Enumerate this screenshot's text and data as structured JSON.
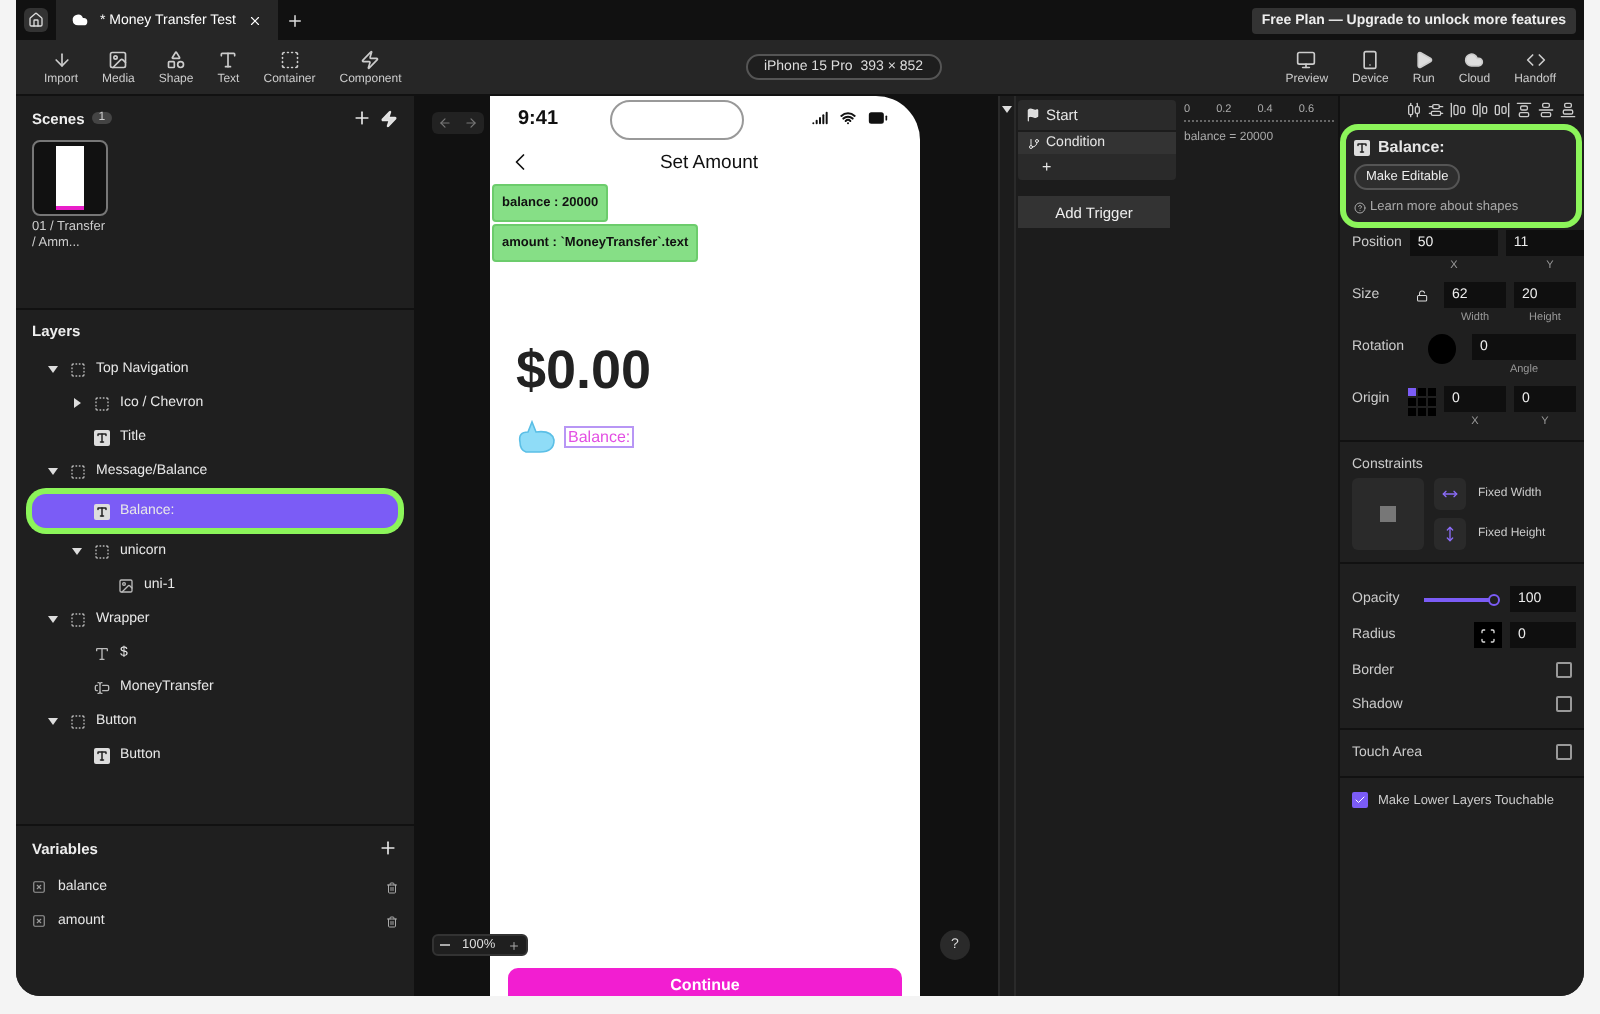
{
  "tabs": [
    {
      "label": "* Money Transfer Test",
      "selected": true
    }
  ],
  "plan_banner": "Free Plan — Upgrade to unlock more features",
  "toolbar": {
    "left": [
      {
        "label": "Import",
        "kind": "import"
      },
      {
        "label": "Media",
        "kind": "media"
      },
      {
        "label": "Shape",
        "kind": "shape"
      },
      {
        "label": "Text",
        "kind": "text"
      },
      {
        "label": "Container",
        "kind": "container"
      },
      {
        "label": "Component",
        "kind": "component"
      }
    ],
    "device": "iPhone 15 Pro  393 × 852",
    "right": [
      {
        "label": "Preview",
        "kind": "preview"
      },
      {
        "label": "Device",
        "kind": "device"
      },
      {
        "label": "Run",
        "kind": "run"
      },
      {
        "label": "Cloud",
        "kind": "cloud"
      },
      {
        "label": "Handoff",
        "kind": "handoff"
      }
    ]
  },
  "scenes": {
    "title": "Scenes",
    "count": "1",
    "items": [
      {
        "caption": "01 / Transfer / Amm...",
        "selected": true
      }
    ]
  },
  "layers": {
    "title": "Layers",
    "items": [
      {
        "name": "Top Navigation",
        "kind": "container",
        "expanded": true,
        "selected": false,
        "children": [
          {
            "name": "Ico / Chevron",
            "kind": "container",
            "expanded": false,
            "selected": false
          },
          {
            "name": "Title",
            "kind": "textbox",
            "selected": false
          }
        ]
      },
      {
        "name": "Message/Balance",
        "kind": "container",
        "expanded": true,
        "selected": false,
        "children": [
          {
            "name": "Balance:",
            "kind": "textbox",
            "selected": true
          },
          {
            "name": "unicorn",
            "kind": "container",
            "expanded": true,
            "selected": false,
            "children": [
              {
                "name": "uni-1",
                "kind": "image",
                "selected": false
              }
            ]
          }
        ]
      },
      {
        "name": "Wrapper",
        "kind": "container",
        "expanded": true,
        "selected": false,
        "children": [
          {
            "name": "$",
            "kind": "text",
            "selected": false
          },
          {
            "name": "MoneyTransfer",
            "kind": "input",
            "selected": false
          }
        ]
      },
      {
        "name": "Button",
        "kind": "container",
        "expanded": true,
        "selected": false,
        "children": [
          {
            "name": "Button",
            "kind": "textbox",
            "selected": false
          }
        ]
      }
    ]
  },
  "variables": {
    "title": "Variables",
    "items": [
      {
        "name": "balance"
      },
      {
        "name": "amount"
      }
    ]
  },
  "canvas": {
    "zoom": "100%",
    "help": "?",
    "phone": {
      "time": "9:41",
      "title": "Set Amount",
      "tags": [
        "balance : 20000",
        "amount : `MoneyTransfer`.text"
      ],
      "amount": "$0.00",
      "balance_label": "Balance:",
      "button": "Continue"
    }
  },
  "logic": {
    "start": "Start",
    "condition": "Condition",
    "add": "+",
    "add_trigger": "Add Trigger",
    "ticks": [
      "0",
      "0.2",
      "0.4",
      "0.6"
    ],
    "expression": "balance = 20000"
  },
  "inspector": {
    "name": "Balance:",
    "highlighted": true,
    "make_editable": "Make Editable",
    "learn_more": "Learn more about shapes",
    "rows": [
      {
        "label": "Position",
        "kind": "position",
        "inputs": [
          {
            "value": "50",
            "caption": "X"
          },
          {
            "value": "11",
            "caption": "Y"
          }
        ]
      },
      {
        "label": "Size",
        "kind": "size",
        "inputs": [
          {
            "value": "62",
            "caption": "Width"
          },
          {
            "value": "20",
            "caption": "Height"
          }
        ]
      },
      {
        "label": "Rotation",
        "kind": "rotation",
        "inputs": [
          {
            "value": "0",
            "caption": "Angle"
          }
        ]
      },
      {
        "label": "Origin",
        "kind": "origin",
        "inputs": [
          {
            "value": "0",
            "caption": "X"
          },
          {
            "value": "0",
            "caption": "Y"
          }
        ]
      }
    ],
    "origin_cells": [
      {
        "selected": true
      },
      {
        "selected": false
      },
      {
        "selected": false
      },
      {
        "selected": false
      },
      {
        "selected": false
      },
      {
        "selected": false
      },
      {
        "selected": false
      },
      {
        "selected": false
      },
      {
        "selected": false
      }
    ],
    "constraints": {
      "title": "Constraints",
      "options": [
        {
          "label": "Fixed Width",
          "kind": "width"
        },
        {
          "label": "Fixed Height",
          "kind": "height"
        }
      ]
    },
    "opacity": {
      "label": "Opacity",
      "level": 1,
      "value": "100"
    },
    "radius": {
      "label": "Radius",
      "value": "0"
    },
    "toggles": [
      {
        "label": "Border",
        "checked": false
      },
      {
        "label": "Shadow",
        "checked": false
      }
    ],
    "touch_area": {
      "label": "Touch Area",
      "checked": false
    },
    "lower_layers": {
      "label": "Make Lower Layers Touchable",
      "checked": true
    }
  }
}
